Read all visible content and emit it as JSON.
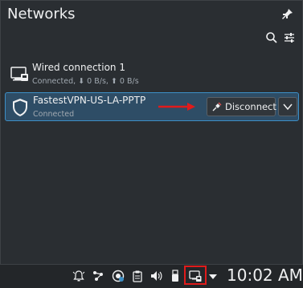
{
  "header": {
    "title": "Networks"
  },
  "connections": [
    {
      "name": "Wired connection 1",
      "status": "Connected, ⬇ 0 B/s, ⬆ 0 B/s"
    },
    {
      "name": "FastestVPN-US-LA-PPTP",
      "status": "Connected",
      "action_label": "Disconnect"
    }
  ],
  "taskbar": {
    "time": "10:02 AM"
  },
  "colors": {
    "accent": "#3d8fc6",
    "highlight_box": "#e01b1b",
    "arrow": "#e01b1b"
  }
}
